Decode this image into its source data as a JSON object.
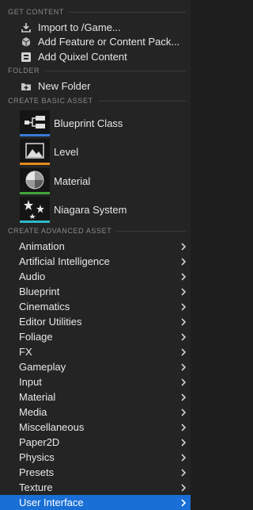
{
  "sections": {
    "get_content": "GET CONTENT",
    "folder": "FOLDER",
    "basic": "CREATE BASIC ASSET",
    "advanced": "CREATE ADVANCED ASSET"
  },
  "get_content_items": [
    {
      "label": "Import to /Game...",
      "icon": "import-icon"
    },
    {
      "label": "Add Feature or Content Pack...",
      "icon": "feature-pack-icon"
    },
    {
      "label": "Add Quixel Content",
      "icon": "quixel-icon"
    }
  ],
  "folder_items": [
    {
      "label": "New Folder",
      "icon": "new-folder-icon"
    }
  ],
  "basic_assets": [
    {
      "label": "Blueprint Class",
      "icon": "blueprint-class-icon",
      "color": "#3a7bd5"
    },
    {
      "label": "Level",
      "icon": "level-icon",
      "color": "#e38a1e"
    },
    {
      "label": "Material",
      "icon": "material-icon",
      "color": "#3fa53a"
    },
    {
      "label": "Niagara System",
      "icon": "niagara-system-icon",
      "color": "#2fb8c9"
    }
  ],
  "advanced_assets": [
    "Animation",
    "Artificial Intelligence",
    "Audio",
    "Blueprint",
    "Cinematics",
    "Editor Utilities",
    "Foliage",
    "FX",
    "Gameplay",
    "Input",
    "Material",
    "Media",
    "Miscellaneous",
    "Paper2D",
    "Physics",
    "Presets",
    "Texture",
    "User Interface"
  ],
  "selected_advanced": "User Interface",
  "colors": {
    "selection": "#1a6fd6",
    "background": "#242424"
  }
}
